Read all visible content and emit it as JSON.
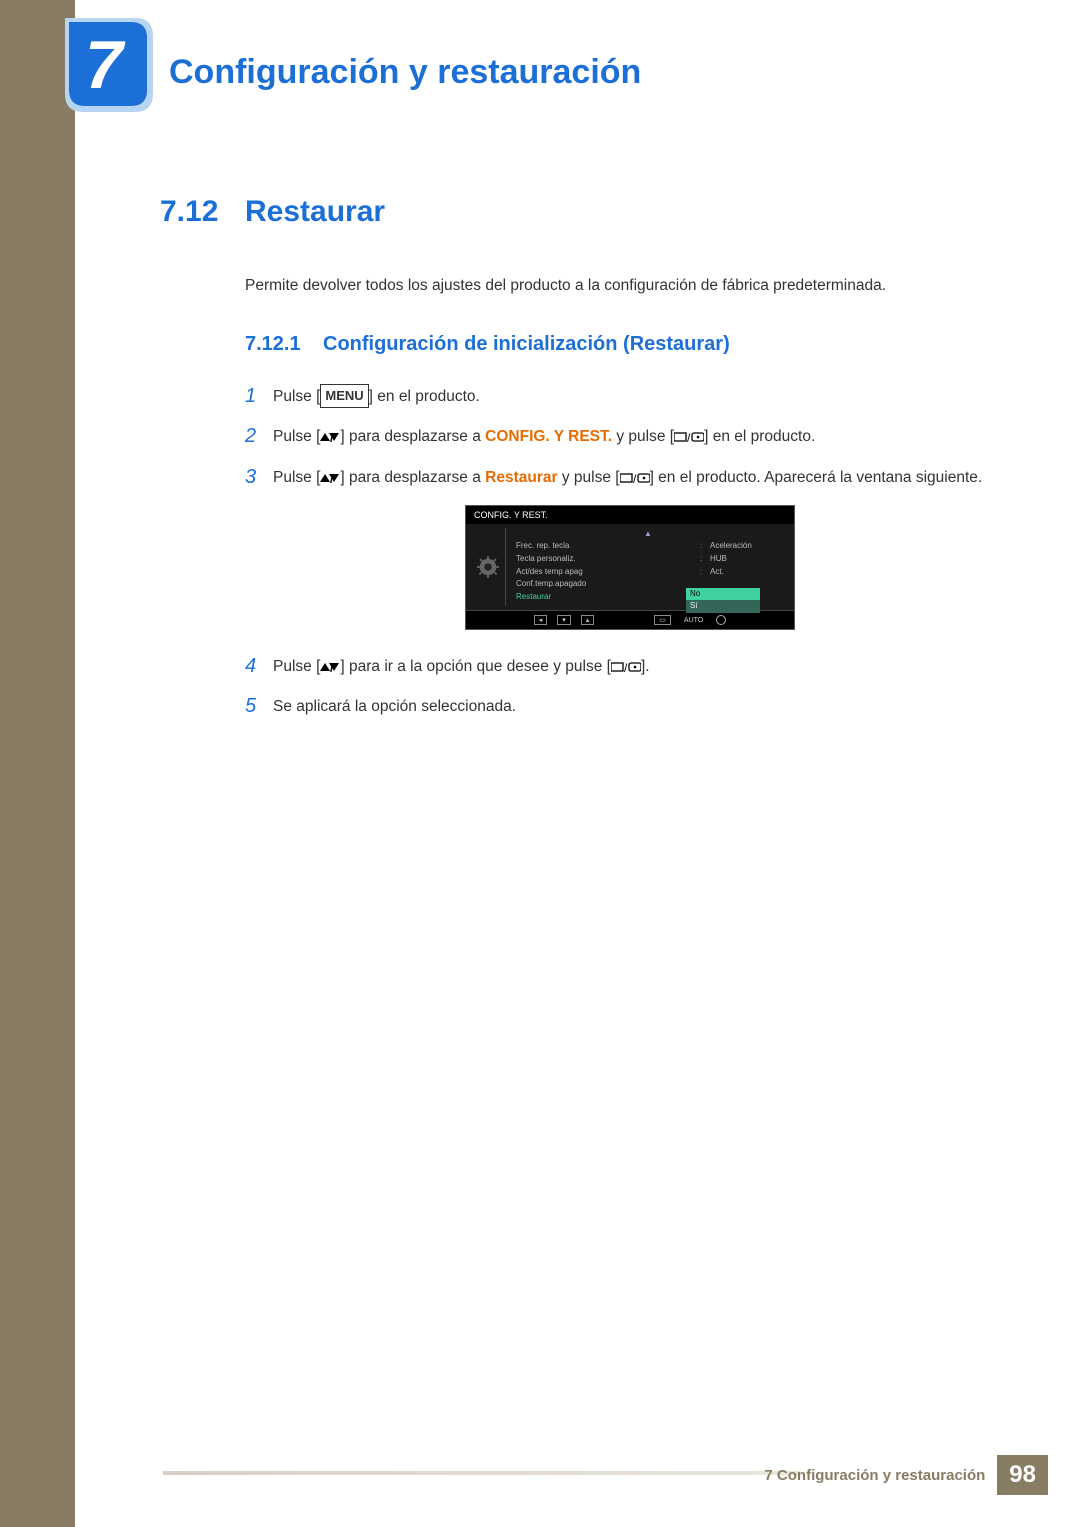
{
  "chapter": {
    "number": "7",
    "title": "Configuración y restauración"
  },
  "section": {
    "number": "7.12",
    "title": "Restaurar",
    "intro": "Permite devolver todos los ajustes del producto a la configuración de fábrica predeterminada."
  },
  "subsection": {
    "number": "7.12.1",
    "title": "Configuración de inicialización (Restaurar)"
  },
  "steps": {
    "s1_a": "Pulse [",
    "s1_menu": "MENU",
    "s1_b": "] en el producto.",
    "s2_a": "Pulse [",
    "s2_b": "] para desplazarse a ",
    "s2_orange": "CONFIG. Y REST.",
    "s2_c": " y pulse [",
    "s2_d": "] en el producto.",
    "s3_a": "Pulse [",
    "s3_b": "] para desplazarse a ",
    "s3_orange": "Restaurar",
    "s3_c": " y pulse [",
    "s3_d": "] en el producto. Aparecerá la ventana siguiente.",
    "s4_a": "Pulse [",
    "s4_b": "] para ir a la opción que desee y pulse [",
    "s4_c": "].",
    "s5": "Se aplicará la opción seleccionada."
  },
  "osd": {
    "title": "CONFIG. Y REST.",
    "rows": [
      {
        "label": "Frec. rep. tecla",
        "val": "Aceleración"
      },
      {
        "label": "Tecla personaliz.",
        "val": "HUB"
      },
      {
        "label": "Act/des temp apag",
        "val": "Act."
      },
      {
        "label": "Conf.temp.apagado",
        "val": ""
      },
      {
        "label": "Restaurar",
        "val": "",
        "active": true
      }
    ],
    "dropdown": {
      "selected": "No",
      "other": "Sí"
    },
    "auto": "AUTO"
  },
  "footer": {
    "text": "7 Configuración y restauración",
    "page": "98"
  }
}
